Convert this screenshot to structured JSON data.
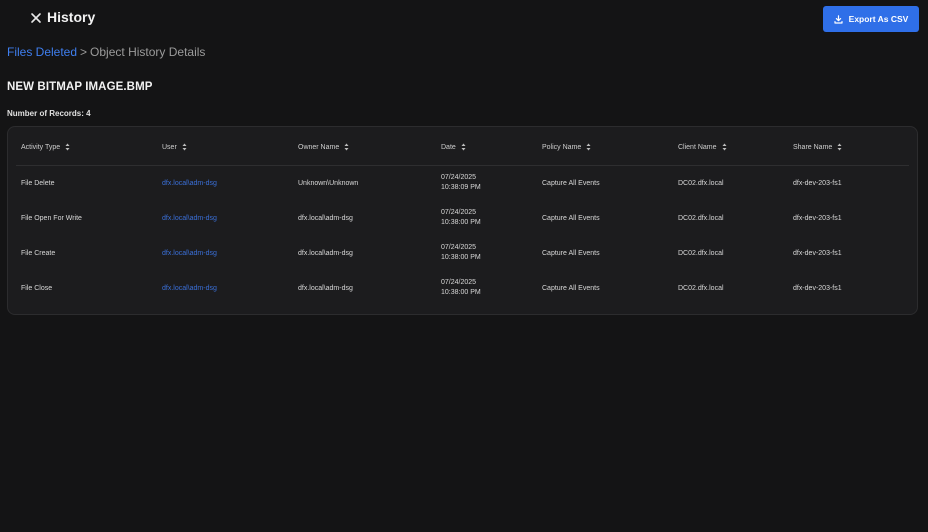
{
  "header": {
    "title": "History",
    "export_label": "Export As CSV"
  },
  "breadcrumb": {
    "parent": "Files Deleted",
    "separator": ">",
    "current": "Object History Details"
  },
  "page_title": "NEW BITMAP IMAGE.BMP",
  "record_count": "Number of Records: 4",
  "table": {
    "columns": [
      "Activity Type",
      "User",
      "Owner Name",
      "Date",
      "Policy Name",
      "Client Name",
      "Share Name"
    ],
    "rows": [
      {
        "activity": "File Delete",
        "user": "dfx.local\\adm-dsg",
        "owner": "Unknown\\Unknown",
        "date_line1": "07/24/2025",
        "date_line2": "10:38:09 PM",
        "policy": "Capture All Events",
        "client": "DC02.dfx.local",
        "share": "dfx-dev-203-fs1"
      },
      {
        "activity": "File Open For Write",
        "user": "dfx.local\\adm-dsg",
        "owner": "dfx.local\\adm-dsg",
        "date_line1": "07/24/2025",
        "date_line2": "10:38:00 PM",
        "policy": "Capture All Events",
        "client": "DC02.dfx.local",
        "share": "dfx-dev-203-fs1"
      },
      {
        "activity": "File Create",
        "user": "dfx.local\\adm-dsg",
        "owner": "dfx.local\\adm-dsg",
        "date_line1": "07/24/2025",
        "date_line2": "10:38:00 PM",
        "policy": "Capture All Events",
        "client": "DC02.dfx.local",
        "share": "dfx-dev-203-fs1"
      },
      {
        "activity": "File Close",
        "user": "dfx.local\\adm-dsg",
        "owner": "dfx.local\\adm-dsg",
        "date_line1": "07/24/2025",
        "date_line2": "10:38:00 PM",
        "policy": "Capture All Events",
        "client": "DC02.dfx.local",
        "share": "dfx-dev-203-fs1"
      }
    ]
  },
  "icons": {
    "close": "close-icon",
    "download": "download-icon",
    "sort": "sort-icon"
  },
  "colors": {
    "background": "#141415",
    "accent": "#2f6fe8",
    "link": "#3f7ff0",
    "card": "#1c1c1e"
  }
}
